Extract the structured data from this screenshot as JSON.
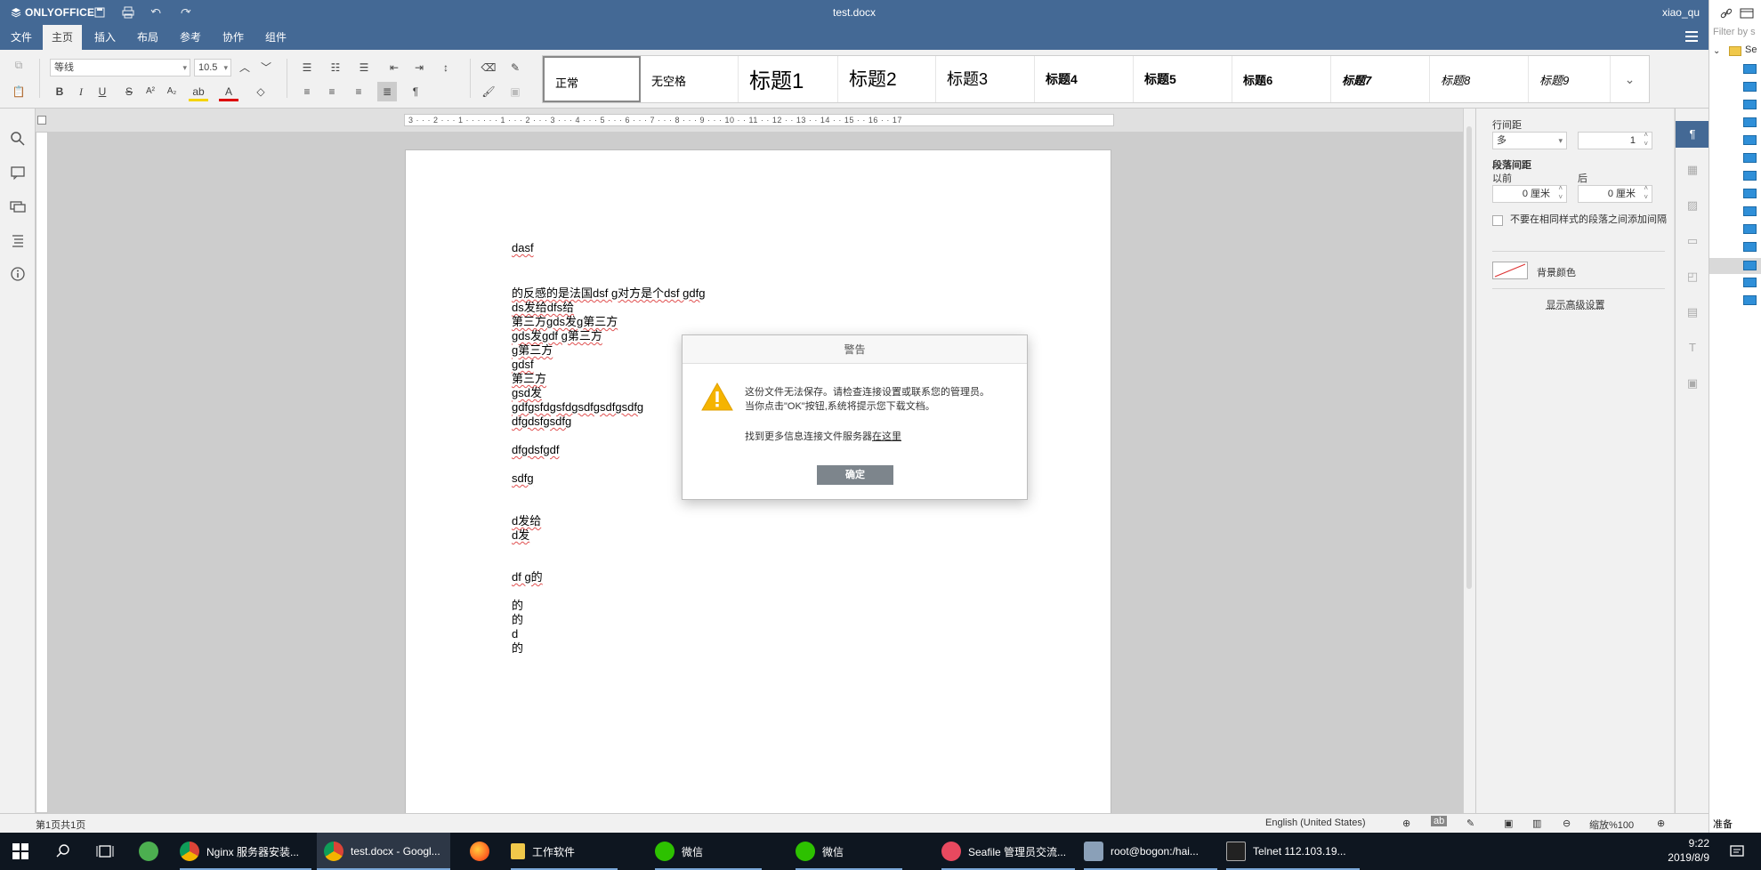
{
  "app": {
    "logo": "ONLYOFFICE",
    "doc_title": "test.docx",
    "user": "xiao_qu"
  },
  "menu": {
    "tabs": [
      "文件",
      "主页",
      "插入",
      "布局",
      "参考",
      "协作",
      "组件"
    ],
    "active_index": 1
  },
  "toolbar": {
    "font_name": "等线",
    "font_size": "10.5",
    "bold": "B",
    "italic": "I",
    "underline": "U",
    "strike": "S",
    "superscript": "A²",
    "subscript": "A₂",
    "styles": [
      "正常",
      "无空格",
      "标题1",
      "标题2",
      "标题3",
      "标题4",
      "标题5",
      "标题6",
      "标题7",
      "标题8",
      "标题9"
    ],
    "selected_style_index": 0
  },
  "ruler": {
    "h_text": "3 · · · 2 · · · 1 · · · · · · 1 · · · 2 · · · 3 · · · 4 · · · 5 · · · 6 · · · 7 · · · 8 · · · 9 · · · 10 · · 11 · · 12 · · 13 · · 14 · · 15 · · 16 · · 17"
  },
  "document": {
    "lines": [
      {
        "text": "dasf",
        "spell": true
      },
      {
        "text": "的反感的是法国dsf g对方是个dsf gdfg",
        "spell": true
      },
      {
        "text": "ds发给dfs给",
        "spell": true
      },
      {
        "text": "第三方gds发g第三方",
        "spell": true
      },
      {
        "text": "gds发gdf g第三方",
        "spell": true
      },
      {
        "text": "g第三方",
        "spell": true
      },
      {
        "text": "gdsf",
        "spell": true
      },
      {
        "text": "第三方",
        "spell": true
      },
      {
        "text": "gsd发",
        "spell": true
      },
      {
        "text": "gdfgsfdgsfdgsdfgsdfgsdfg",
        "spell": true
      },
      {
        "text": "dfgdsfgsdfg",
        "spell": true
      },
      {
        "text": "dfgdsfgdf",
        "spell": true
      },
      {
        "text": "sdfg",
        "spell": true
      },
      {
        "text": "d发给",
        "spell": true
      },
      {
        "text": "d发",
        "spell": true
      },
      {
        "text": "df g的",
        "spell": true
      },
      {
        "text": "的",
        "spell": false
      },
      {
        "text": "的",
        "spell": false
      },
      {
        "text": "d",
        "spell": false
      },
      {
        "text": "的",
        "spell": false
      }
    ]
  },
  "right_panel": {
    "line_spacing_label": "行间距",
    "line_spacing_mode": "多",
    "line_spacing_value": "1",
    "para_spacing_label": "段落间距",
    "before_label": "以前",
    "after_label": "后",
    "before_value": "0 厘米",
    "after_value": "0 厘米",
    "no_space_checkbox_label": "不要在相同样式的段落之间添加间隔",
    "bg_color_label": "背景颜色",
    "advanced_link": "显示高级设置"
  },
  "status_bar": {
    "page_info": "第1页共1页",
    "language": "English (United States)",
    "zoom": "缩放%100"
  },
  "dialog": {
    "title": "警告",
    "message_line1": "这份文件无法保存。请检查连接设置或联系您的管理员。",
    "message_line2": "当你点击\"OK\"按钮,系统将提示您下载文档。",
    "more_info_prefix": "找到更多信息连接文件服务器",
    "more_info_link": "在这里",
    "ok_button": "确定"
  },
  "side_pane": {
    "filter_placeholder": "Filter by s",
    "root_label": "Se",
    "status": "准备"
  },
  "taskbar": {
    "items": [
      {
        "label": "Nginx 服务器安装..."
      },
      {
        "label": "test.docx - Googl..."
      },
      {
        "label": "工作软件"
      },
      {
        "label": "微信"
      },
      {
        "label": "微信"
      },
      {
        "label": "Seafile 管理员交流..."
      },
      {
        "label": "root@bogon:/hai..."
      },
      {
        "label": "Telnet 112.103.19..."
      }
    ],
    "time": "9:22",
    "date": "2019/8/9"
  },
  "colors": {
    "header_blue": "#446995",
    "warning_yellow": "#f5b400",
    "taskbar": "#0e1620"
  }
}
